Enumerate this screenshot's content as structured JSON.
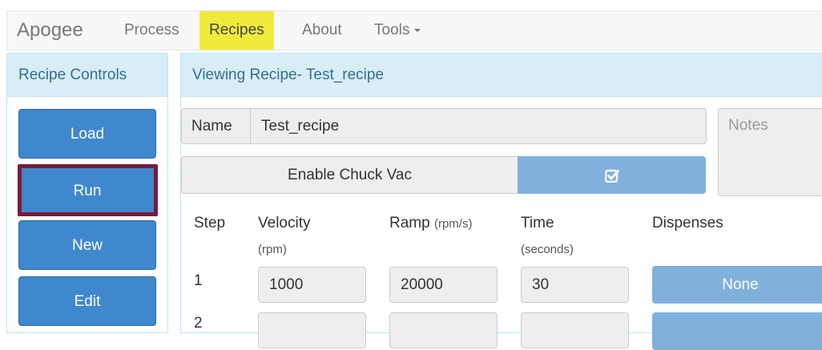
{
  "navbar": {
    "brand": "Apogee",
    "items": [
      {
        "label": "Process"
      },
      {
        "label": "Recipes",
        "active": true
      },
      {
        "label": "About"
      },
      {
        "label": "Tools"
      }
    ]
  },
  "sidebar": {
    "heading": "Recipe Controls",
    "buttons": [
      {
        "label": "Load"
      },
      {
        "label": "Run"
      },
      {
        "label": "New"
      },
      {
        "label": "Edit"
      }
    ]
  },
  "recipe": {
    "heading": "Viewing Recipe- Test_recipe",
    "name_label": "Name",
    "name_value": "Test_recipe",
    "notes_placeholder": "Notes",
    "chuck_vac_label": "Enable Chuck Vac",
    "chuck_vac_checked": true,
    "columns": {
      "step": "Step",
      "velocity": "Velocity",
      "velocity_unit": "(rpm)",
      "ramp": "Ramp",
      "ramp_unit": "(rpm/s)",
      "time": "Time",
      "time_unit": "(seconds)",
      "dispenses": "Dispenses"
    },
    "steps": [
      {
        "step": "1",
        "velocity": "1000",
        "ramp": "20000",
        "time": "30",
        "dispense": "None"
      },
      {
        "step": "2",
        "velocity": "",
        "ramp": "",
        "time": "",
        "dispense": ""
      }
    ]
  },
  "colors": {
    "nav_active_highlight": "#f0ea3c",
    "primary_button": "#3f88ce",
    "run_highlight_border": "#7a1b3a",
    "panel_heading": "#d9edf7"
  }
}
